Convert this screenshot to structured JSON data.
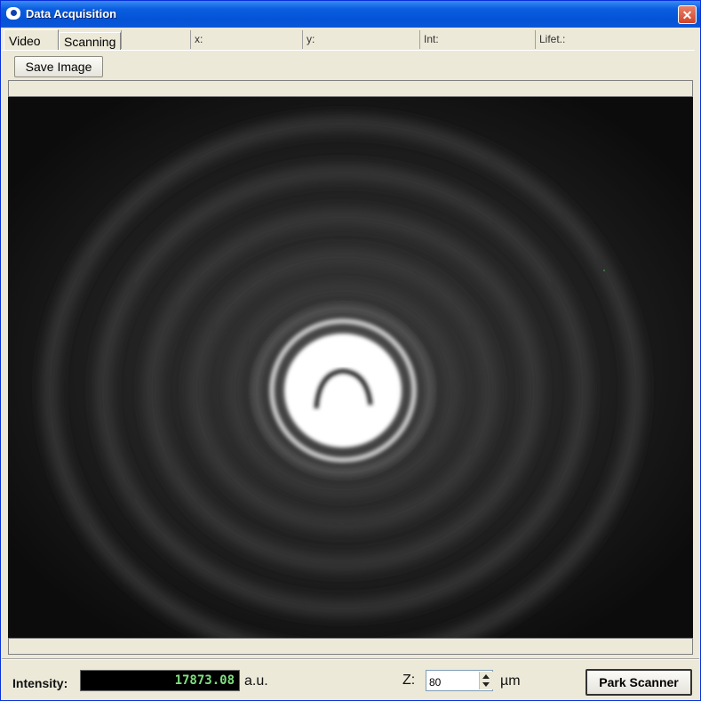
{
  "window": {
    "title": "Data Acquisition"
  },
  "tabs": [
    {
      "label": "Video",
      "active": true
    },
    {
      "label": "Scanning",
      "active": false
    }
  ],
  "readouts": {
    "x_label": "x:",
    "y_label": "y:",
    "int_label": "Int:",
    "lifet_label": "Lifet.:"
  },
  "toolbar": {
    "save_label": "Save Image"
  },
  "status": {
    "intensity_label": "Intensity:",
    "intensity_value": "17873.08",
    "intensity_unit": "a.u.",
    "z_label": "Z:",
    "z_value": "80",
    "z_unit": "µm",
    "park_label": "Park Scanner"
  },
  "colors": {
    "title_bar": "#0453d6",
    "display_text": "#7fe07f",
    "display_bg": "#000000"
  },
  "icons": {
    "app": "eye-icon",
    "close": "close-icon",
    "spin": "spin-updown-icon"
  }
}
